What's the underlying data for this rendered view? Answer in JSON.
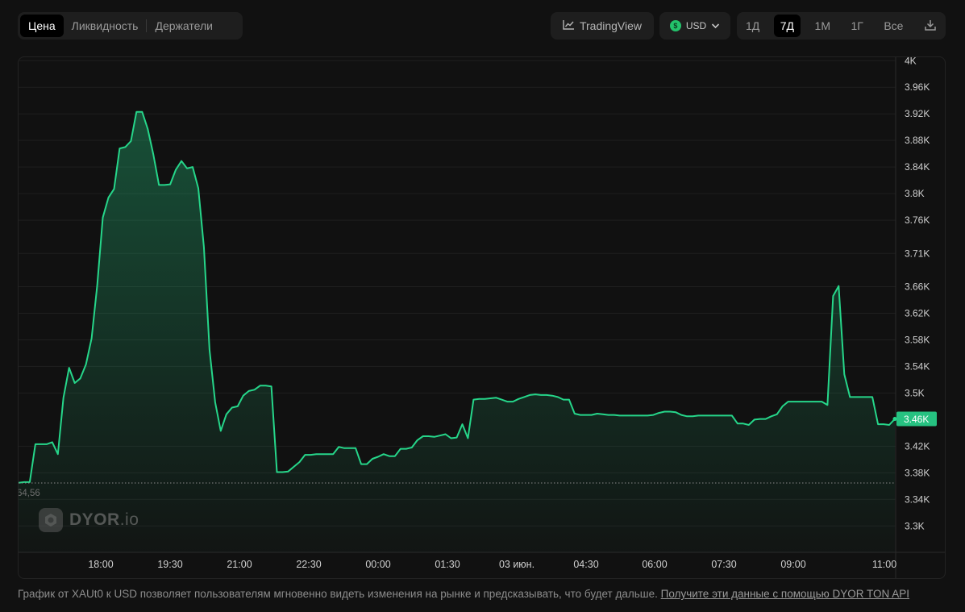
{
  "tabs": [
    {
      "label": "Цена",
      "active": true
    },
    {
      "label": "Ликвидность",
      "active": false
    },
    {
      "label": "Держатели",
      "active": false
    }
  ],
  "tradingview_label": "TradingView",
  "currency": {
    "label": "USD",
    "coin_symbol": "$"
  },
  "ranges": [
    {
      "label": "1Д",
      "active": false
    },
    {
      "label": "7Д",
      "active": true
    },
    {
      "label": "1М",
      "active": false
    },
    {
      "label": "1Г",
      "active": false
    },
    {
      "label": "Все",
      "active": false
    }
  ],
  "logo": {
    "brand": "DYOR",
    "suffix": ".io"
  },
  "footer": {
    "text": "График от XAUt0 к USD позволяет пользователям мгновенно видеть изменения на рынке и предсказывать, что будет дальше.",
    "link": "Получите эти данные с помощью DYOR TON API"
  },
  "colors": {
    "line": "#26d68a",
    "price_tag": "#26c281",
    "background": "#111111"
  },
  "chart_data": {
    "type": "area",
    "x_ticks": [
      "18:00",
      "19:30",
      "21:00",
      "22:30",
      "00:00",
      "01:30",
      "03 июн.",
      "04:30",
      "06:00",
      "07:30",
      "09:00",
      "11:00"
    ],
    "y_ticks": [
      {
        "label": "4K",
        "value": 4000
      },
      {
        "label": "3.96K",
        "value": 3960
      },
      {
        "label": "3.92K",
        "value": 3920
      },
      {
        "label": "3.88K",
        "value": 3880
      },
      {
        "label": "3.84K",
        "value": 3840
      },
      {
        "label": "3.8K",
        "value": 3800
      },
      {
        "label": "3.76K",
        "value": 3760
      },
      {
        "label": "3.71K",
        "value": 3710
      },
      {
        "label": "3.66K",
        "value": 3660
      },
      {
        "label": "3.62K",
        "value": 3620
      },
      {
        "label": "3.58K",
        "value": 3580
      },
      {
        "label": "3.54K",
        "value": 3540
      },
      {
        "label": "3.5K",
        "value": 3500
      },
      {
        "label": "3.42K",
        "value": 3420
      },
      {
        "label": "3.38K",
        "value": 3380
      },
      {
        "label": "3.34K",
        "value": 3340
      },
      {
        "label": "3.3K",
        "value": 3300
      }
    ],
    "current_price_label": "3.46K",
    "baseline_label": "64,56",
    "baseline_value": 3364.56,
    "series": [
      {
        "values": [
          3365,
          3366,
          3366,
          3423,
          3423,
          3423,
          3426,
          3408,
          3493,
          3538,
          3515,
          3522,
          3543,
          3582,
          3662,
          3764,
          3794,
          3807,
          3868,
          3870,
          3879,
          3923,
          3923,
          3897,
          3859,
          3813,
          3813,
          3814,
          3836,
          3849,
          3838,
          3840,
          3808,
          3720,
          3565,
          3486,
          3443,
          3468,
          3478,
          3480,
          3496,
          3503,
          3505,
          3511,
          3511,
          3510,
          3381,
          3381,
          3382,
          3389,
          3396,
          3407,
          3407,
          3408,
          3408,
          3408,
          3408,
          3419,
          3417,
          3417,
          3417,
          3393,
          3393,
          3401,
          3404,
          3408,
          3405,
          3405,
          3416,
          3416,
          3418,
          3429,
          3435,
          3435,
          3434,
          3436,
          3438,
          3432,
          3433,
          3453,
          3432,
          3490,
          3491,
          3491,
          3492,
          3493,
          3490,
          3487,
          3487,
          3491,
          3494,
          3497,
          3498,
          3497,
          3497,
          3496,
          3494,
          3490,
          3490,
          3469,
          3467,
          3467,
          3467,
          3469,
          3468,
          3467,
          3467,
          3466,
          3466,
          3466,
          3466,
          3466,
          3466,
          3467,
          3470,
          3472,
          3472,
          3471,
          3467,
          3465,
          3465,
          3466,
          3466,
          3466,
          3466,
          3466,
          3466,
          3466,
          3454,
          3454,
          3452,
          3460,
          3461,
          3461,
          3465,
          3468,
          3480,
          3487,
          3487,
          3487,
          3487,
          3487,
          3487,
          3487,
          3482,
          3646,
          3661,
          3528,
          3494,
          3494,
          3494,
          3494,
          3494,
          3453,
          3453,
          3452,
          3461
        ]
      }
    ],
    "ylabel": "",
    "xlabel": ""
  }
}
